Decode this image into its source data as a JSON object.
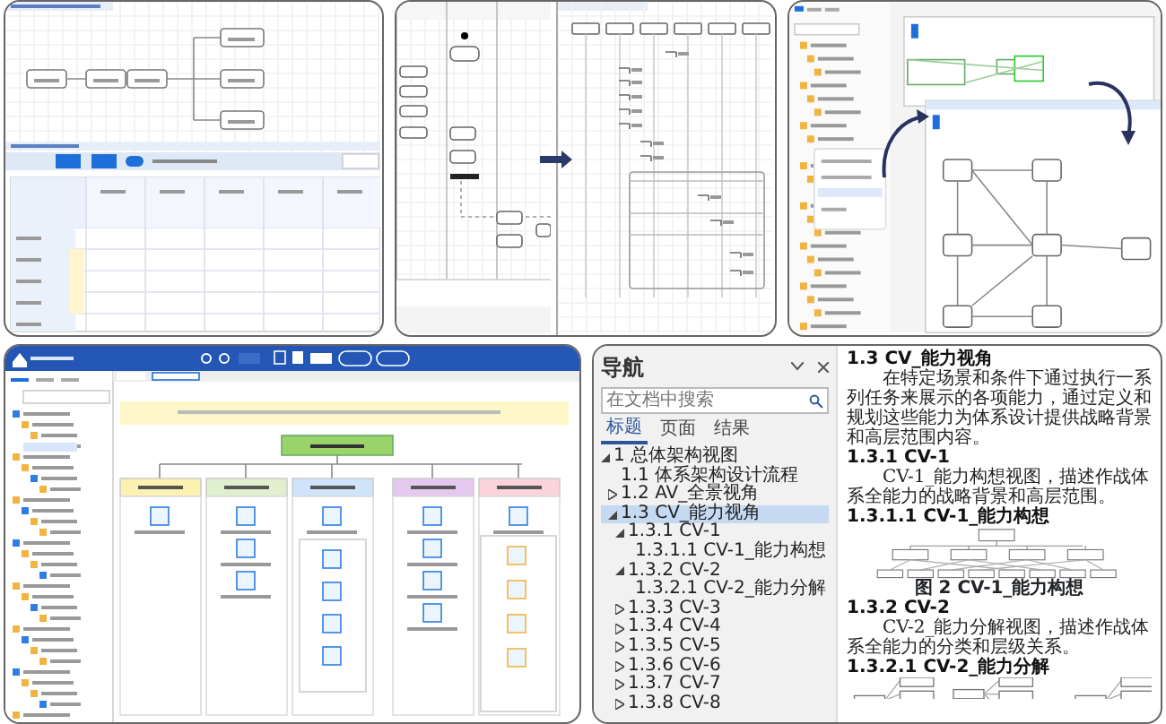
{
  "document_window": {
    "navigation": {
      "title": "导航",
      "search": {
        "placeholder": "在文档中搜索"
      },
      "tabs": [
        {
          "label": "标题",
          "selected": true
        },
        {
          "label": "页面",
          "selected": false
        },
        {
          "label": "结果",
          "selected": false
        }
      ],
      "headings": [
        {
          "label": "1 总体架构视图",
          "expanded": true,
          "selected": false,
          "children": [
            {
              "label": "1.1 体系架构设计流程",
              "selected": false
            },
            {
              "label": "1.2 AV_全景视角",
              "expanded": false,
              "selected": false
            },
            {
              "label": "1.3 CV_能力视角",
              "expanded": true,
              "selected": true,
              "children": [
                {
                  "label": "1.3.1 CV-1",
                  "expanded": true,
                  "selected": false,
                  "children": [
                    {
                      "label": "1.3.1.1 CV-1_能力构想",
                      "selected": false
                    }
                  ]
                },
                {
                  "label": "1.3.2 CV-2",
                  "expanded": true,
                  "selected": false,
                  "children": [
                    {
                      "label": "1.3.2.1 CV-2_能力分解",
                      "selected": false
                    }
                  ]
                },
                {
                  "label": "1.3.3 CV-3",
                  "expanded": false,
                  "selected": false
                },
                {
                  "label": "1.3.4 CV-4",
                  "expanded": false,
                  "selected": false
                },
                {
                  "label": "1.3.5 CV-5",
                  "expanded": false,
                  "selected": false
                },
                {
                  "label": "1.3.6 CV-6",
                  "expanded": false,
                  "selected": false
                },
                {
                  "label": "1.3.7 CV-7",
                  "expanded": false,
                  "selected": false
                },
                {
                  "label": "1.3.8 CV-8",
                  "expanded": false,
                  "selected": false
                }
              ]
            }
          ]
        }
      ]
    },
    "document": [
      {
        "kind": "heading",
        "text": "1.3 CV_能力视角"
      },
      {
        "kind": "paragraph",
        "text": "在特定场景和条件下通过执行一系列任务来展示的各项能力，通过定义和规划这些能力为体系设计提供战略背景和高层范围内容。"
      },
      {
        "kind": "heading",
        "text": "1.3.1 CV-1"
      },
      {
        "kind": "paragraph",
        "text": "CV-1_能力构想视图，描述作战体系全能力的战略背景和高层范围。"
      },
      {
        "kind": "heading",
        "text": "1.3.1.1 CV-1_能力构想"
      },
      {
        "kind": "org-chart"
      },
      {
        "kind": "caption",
        "text": "图 2 CV-1_能力构想"
      },
      {
        "kind": "heading",
        "text": "1.3.2 CV-2"
      },
      {
        "kind": "paragraph",
        "text": "CV-2_能力分解视图，描述作战体系全能力的分类和层级关系。"
      },
      {
        "kind": "heading",
        "text": "1.3.2.1 CV-2_能力分解"
      },
      {
        "kind": "tree-chart"
      }
    ]
  }
}
